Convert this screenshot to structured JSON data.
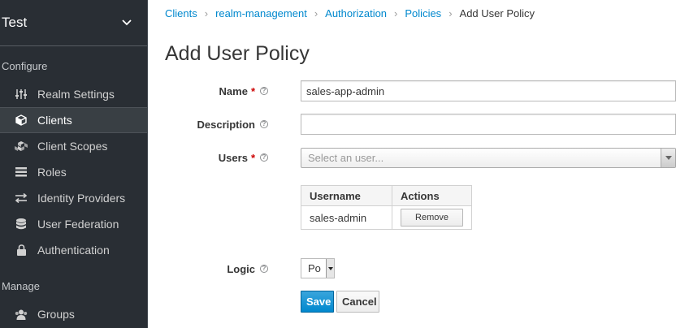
{
  "sidebar": {
    "realm_name": "Test",
    "configure_title": "Configure",
    "manage_title": "Manage",
    "items": [
      {
        "label": "Realm Settings",
        "icon": "sliders-icon"
      },
      {
        "label": "Clients",
        "icon": "cube-icon"
      },
      {
        "label": "Client Scopes",
        "icon": "cubes-icon"
      },
      {
        "label": "Roles",
        "icon": "list-icon"
      },
      {
        "label": "Identity Providers",
        "icon": "exchange-icon"
      },
      {
        "label": "User Federation",
        "icon": "database-icon"
      },
      {
        "label": "Authentication",
        "icon": "lock-icon"
      }
    ],
    "manage_items": [
      {
        "label": "Groups",
        "icon": "users-icon"
      }
    ]
  },
  "breadcrumb": {
    "items": [
      "Clients",
      "realm-management",
      "Authorization",
      "Policies"
    ],
    "current": "Add User Policy"
  },
  "page_title": "Add User Policy",
  "form": {
    "name_label": "Name",
    "name_value": "sales-app-admin",
    "description_label": "Description",
    "description_value": "",
    "users_label": "Users",
    "users_placeholder": "Select an user...",
    "required_marker": "*",
    "users_table": {
      "headers": [
        "Username",
        "Actions"
      ],
      "rows": [
        {
          "username": "sales-admin",
          "action": "Remove"
        }
      ]
    },
    "logic_label": "Logic",
    "logic_value": "Po"
  },
  "buttons": {
    "save": "Save",
    "cancel": "Cancel"
  },
  "colors": {
    "sidebar_bg": "#292e34",
    "link": "#0088ce",
    "primary": "#0088ce",
    "required": "#cc0000"
  }
}
